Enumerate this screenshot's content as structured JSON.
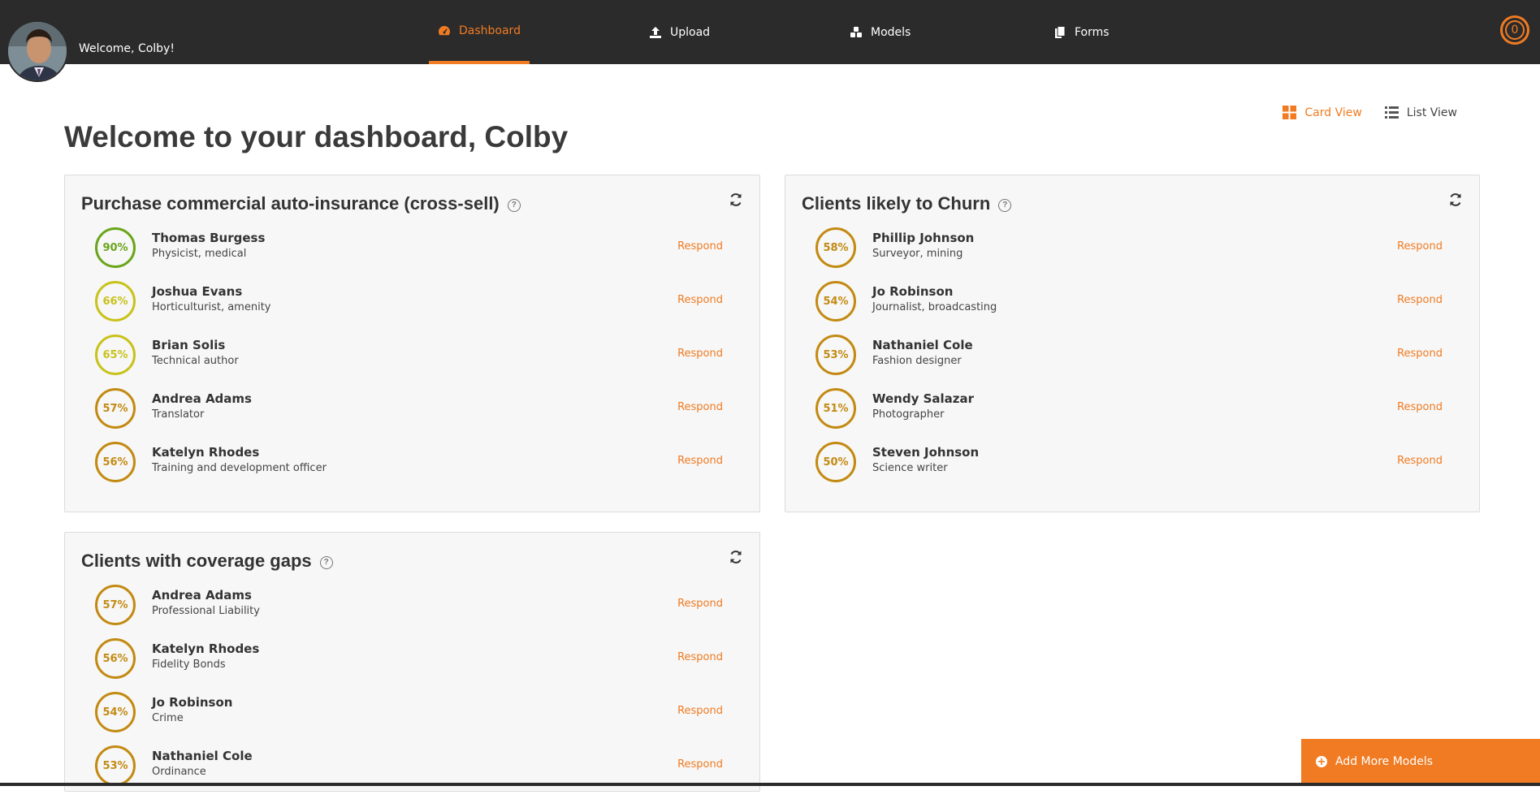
{
  "user": {
    "welcome": "Welcome, Colby!"
  },
  "nav": [
    {
      "label": "Dashboard",
      "icon": "dashboard-gauge-icon",
      "active": true
    },
    {
      "label": "Upload",
      "icon": "upload-icon",
      "active": false
    },
    {
      "label": "Models",
      "icon": "models-cubes-icon",
      "active": false
    },
    {
      "label": "Forms",
      "icon": "forms-copy-icon",
      "active": false
    }
  ],
  "notifications": {
    "count": "0"
  },
  "view_toggle": {
    "card": "Card View",
    "list": "List View",
    "selected": "Card View"
  },
  "page": {
    "title": "Welcome to your dashboard, Colby"
  },
  "respond_label": "Respond",
  "cards": [
    {
      "title": "Purchase commercial auto-insurance (cross-sell)",
      "rows": [
        {
          "score": "90%",
          "name": "Thomas Burgess",
          "sub": "Physicist, medical",
          "color": "#6aa51a"
        },
        {
          "score": "66%",
          "name": "Joshua Evans",
          "sub": "Horticulturist, amenity",
          "color": "#c8c21b"
        },
        {
          "score": "65%",
          "name": "Brian Solis",
          "sub": "Technical author",
          "color": "#c8c21b"
        },
        {
          "score": "57%",
          "name": "Andrea Adams",
          "sub": "Translator",
          "color": "#c38a12"
        },
        {
          "score": "56%",
          "name": "Katelyn Rhodes",
          "sub": "Training and development officer",
          "color": "#c38a12"
        }
      ]
    },
    {
      "title": "Clients likely to Churn",
      "rows": [
        {
          "score": "58%",
          "name": "Phillip Johnson",
          "sub": "Surveyor, mining",
          "color": "#c38a12"
        },
        {
          "score": "54%",
          "name": "Jo Robinson",
          "sub": "Journalist, broadcasting",
          "color": "#c38a12"
        },
        {
          "score": "53%",
          "name": "Nathaniel Cole",
          "sub": "Fashion designer",
          "color": "#c38a12"
        },
        {
          "score": "51%",
          "name": "Wendy Salazar",
          "sub": "Photographer",
          "color": "#c38a12"
        },
        {
          "score": "50%",
          "name": "Steven Johnson",
          "sub": "Science writer",
          "color": "#c38a12"
        }
      ]
    },
    {
      "title": "Clients with coverage gaps",
      "rows": [
        {
          "score": "57%",
          "name": "Andrea Adams",
          "sub": "Professional Liability",
          "color": "#c38a12"
        },
        {
          "score": "56%",
          "name": "Katelyn Rhodes",
          "sub": "Fidelity Bonds",
          "color": "#c38a12"
        },
        {
          "score": "54%",
          "name": "Jo Robinson",
          "sub": "Crime",
          "color": "#c38a12"
        },
        {
          "score": "53%",
          "name": "Nathaniel Cole",
          "sub": "Ordinance",
          "color": "#c38a12"
        }
      ]
    }
  ],
  "add_models": {
    "label": "Add More Models"
  },
  "colors": {
    "accent": "#f07b22",
    "nav_bg": "#2b2b2b"
  }
}
